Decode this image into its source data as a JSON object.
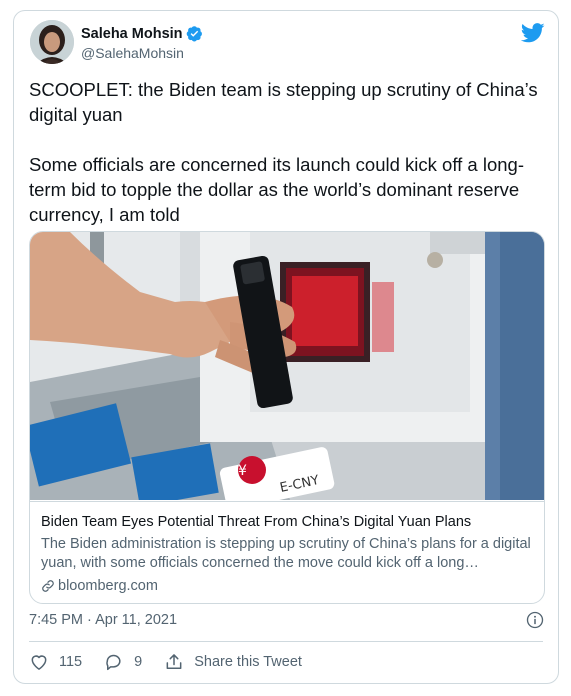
{
  "author": {
    "name": "Saleha Mohsin",
    "handle": "@SalehaMohsin"
  },
  "tweet": {
    "paragraph1": "SCOOPLET: the Biden team is stepping up scrutiny of China’s digital yuan",
    "paragraph2": "Some officials are concerned its launch could kick off a long-term bid to topple the dollar as the world’s dominant reserve currency, I am told",
    "timestamp": "7:45 PM · Apr 11, 2021"
  },
  "card": {
    "image_text": "E-CNY",
    "title": "Biden Team Eyes Potential Threat From China’s Digital Yuan Plans",
    "description": "The Biden administration is stepping up scrutiny of China’s plans for a digital yuan, with some officials concerned the move could kick off a long…",
    "domain": "bloomberg.com"
  },
  "actions": {
    "likes": "115",
    "replies": "9",
    "share_label": "Share this Tweet"
  },
  "colors": {
    "accent": "#1d9bf0",
    "text": "#0f1419",
    "secondary": "#536471",
    "border": "#cfd9de"
  },
  "icons": [
    "verified-badge-icon",
    "twitter-bird-icon",
    "link-icon",
    "info-icon",
    "heart-icon",
    "reply-icon",
    "share-icon"
  ]
}
